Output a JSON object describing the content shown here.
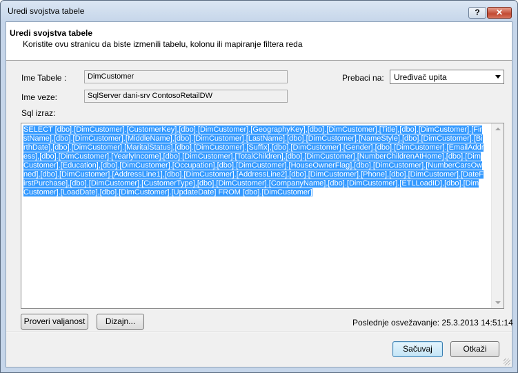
{
  "window": {
    "title": "Uredi svojstva tabele",
    "help_glyph": "?",
    "close_glyph": "✕"
  },
  "header": {
    "title": "Uredi svojstva tabele",
    "subtitle": "Koristite ovu stranicu da biste izmenili tabelu, kolonu ili mapiranje filtera reda"
  },
  "form": {
    "table_name_label": "Ime Tabele :",
    "table_name_value": "DimCustomer",
    "connection_label": "Ime veze:",
    "connection_value": "SqlServer dani-srv ContosoRetailDW",
    "switch_label": "Prebaci na:",
    "switch_value": "Uređivač upita",
    "sql_label": "Sql izraz:",
    "sql_text": "SELECT [dbo].[DimCustomer].[CustomerKey],[dbo].[DimCustomer].[GeographyKey],[dbo].[DimCustomer].[Title],[dbo].[DimCustomer].[FirstName],[dbo].[DimCustomer].[MiddleName],[dbo].[DimCustomer].[LastName],[dbo].[DimCustomer].[NameStyle],[dbo].[DimCustomer].[BirthDate],[dbo].[DimCustomer].[MaritalStatus],[dbo].[DimCustomer].[Suffix],[dbo].[DimCustomer].[Gender],[dbo].[DimCustomer].[EmailAddress],[dbo].[DimCustomer].[YearlyIncome],[dbo].[DimCustomer].[TotalChildren],[dbo].[DimCustomer].[NumberChildrenAtHome],[dbo].[DimCustomer].[Education],[dbo].[DimCustomer].[Occupation],[dbo].[DimCustomer].[HouseOwnerFlag],[dbo].[DimCustomer].[NumberCarsOwned],[dbo].[DimCustomer].[AddressLine1],[dbo].[DimCustomer].[AddressLine2],[dbo].[DimCustomer].[Phone],[dbo].[DimCustomer].[DateFirstPurchase],[dbo].[DimCustomer].[CustomerType],[dbo].[DimCustomer].[CompanyName],[dbo].[DimCustomer].[ETLLoadID],[dbo].[DimCustomer].[LoadDate],[dbo].[DimCustomer].[UpdateDate]                    FROM [dbo].[DimCustomer]"
  },
  "buttons": {
    "validate": "Proveri valjanost",
    "design": "Dizajn...",
    "save": "Sačuvaj",
    "cancel": "Otkaži"
  },
  "status": {
    "last_refresh": "Poslednje osvežavanje: 25.3.2013 14:51:14"
  },
  "colors": {
    "selection": "#3399ff",
    "default_button": "#c4e5f6",
    "close_button": "#c24a33"
  }
}
